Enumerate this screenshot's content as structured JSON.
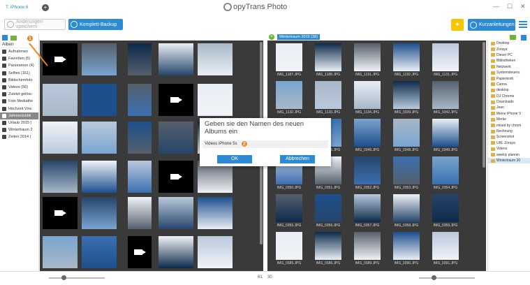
{
  "titlebar": {
    "device": "T: iPhone 6",
    "app_title": "CopyTrans Photo",
    "app_title_rest": "opyTrans Photo",
    "minimize": "—",
    "maximize": "☐",
    "close": "✕"
  },
  "toolbar": {
    "save_label": "Änderungen speichern",
    "backup_label": "Komplett-Backup",
    "guides_label": "Kurzanleitungen"
  },
  "sidebar": {
    "header": "Alben",
    "items": [
      {
        "label": "Aufnahmen"
      },
      {
        "label": "Favoriten (5)"
      },
      {
        "label": "Panoramen (4)"
      },
      {
        "label": "Selfies (161)"
      },
      {
        "label": "Bildschirmfoto"
      },
      {
        "label": "Videos (56)"
      },
      {
        "label": "Zuletzt gelösc"
      },
      {
        "label": "Foto Mediathe"
      },
      {
        "label": "Hochzeit Vinc"
      },
      {
        "label": "Jahresrückbli"
      },
      {
        "label": "Urlaub 2015 ("
      },
      {
        "label": "Wintertraum 2"
      },
      {
        "label": "Zeiten 2014 ("
      }
    ]
  },
  "right_panel": {
    "album_tag": "Wintertraum 2015 (38)",
    "rows": [
      [
        "IMG_1187.JPG",
        "IMG_1188.JPG",
        "IMG_1191.JPG",
        "IMG_1192.JPG",
        "IMG_1131.JPG"
      ],
      [
        "IMG_1132.JPG",
        "IMG_1133.JPG",
        "IMG_1134.JPG",
        "IMG_0339.JPG",
        "IMG_0342.JPG"
      ],
      [
        "IMG_0343.JPG",
        "IMG_0345.JPG",
        "IMG_0346.JPG",
        "IMG_0348.JPG",
        "IMG_0349.JPG"
      ],
      [
        "IMG_0350.JPG",
        "IMG_0351.JPG",
        "IMG_0352.JPG",
        "IMG_0353.JPG",
        "IMG_0354.JPG"
      ],
      [
        "IMG_0355.JPG",
        "IMG_0356.JPG",
        "IMG_0357.JPG",
        "IMG_0358.JPG",
        "IMG_0359.JPG"
      ],
      [
        "IMG_0385.JPG",
        "IMG_0386.JPG",
        "IMG_0389.JPG",
        "IMG_0390.JPG",
        "IMG_0391.JPG"
      ]
    ]
  },
  "tree": {
    "items": [
      {
        "label": "Desktop"
      },
      {
        "label": "Zoraya"
      },
      {
        "label": "Dieser PC"
      },
      {
        "label": "Bibliotheken"
      },
      {
        "label": "Netzwerk"
      },
      {
        "label": "Systemsteueru"
      },
      {
        "label": "Papierkorb"
      },
      {
        "label": "Canna"
      },
      {
        "label": "desktop"
      },
      {
        "label": "DJ Chrome"
      },
      {
        "label": "Downloads"
      },
      {
        "label": "Jean"
      },
      {
        "label": "Meine iPhone V"
      },
      {
        "label": "Merke"
      },
      {
        "label": "mixed by chrom"
      },
      {
        "label": "Rechnung"
      },
      {
        "label": "Screenshot"
      },
      {
        "label": "URL Zoraya"
      },
      {
        "label": "Videos"
      },
      {
        "label": "weekly plannin"
      },
      {
        "label": "Wintertraum 20"
      }
    ]
  },
  "bottom": {
    "left_count": "61",
    "right_count": "30"
  },
  "dialog": {
    "title": "Geben sie den Namen des neuen Albums ein",
    "input_value": "Videos iPhone 5s",
    "ok_label": "OK",
    "cancel_label": "Abbrechen"
  },
  "badges": {
    "step1": "1",
    "step2": "2"
  },
  "colors": {
    "accent": "#2d8bd5",
    "panel_bg": "#3a3a3a",
    "badge": "#f07f1e",
    "bulb": "#f7c600",
    "folder_green": "#6fb33a"
  }
}
